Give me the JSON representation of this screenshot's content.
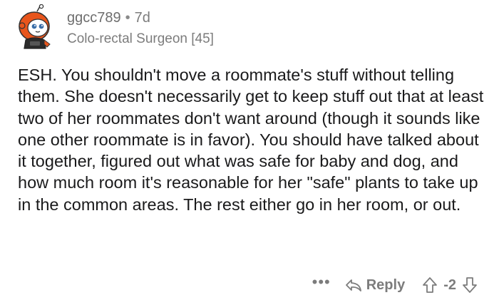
{
  "comment": {
    "author": "ggcc789",
    "age": "7d",
    "flair": "Colo-rectal Surgeon [45]",
    "body": "ESH.  You shouldn't move a roommate's stuff without telling them.  She doesn't necessarily get to keep stuff out that at least two of her roommates don't want around (though it sounds like one other roommate is in favor).  You should have talked about it together, figured out what was safe for baby and dog, and how much room it's reasonable for her \"safe\" plants to take up in the common areas.  The rest either go in her room, or out.",
    "score": "-2"
  },
  "actions": {
    "more": "•••",
    "reply_label": "Reply"
  },
  "icons": {
    "reply": "reply-arrow-icon",
    "upvote": "upvote-arrow-icon",
    "downvote": "downvote-arrow-icon",
    "avatar": "snoo-avatar"
  },
  "colors": {
    "meta": "#7c7c7c",
    "body": "#1a1a1b",
    "avatar_orange": "#e8551c"
  }
}
